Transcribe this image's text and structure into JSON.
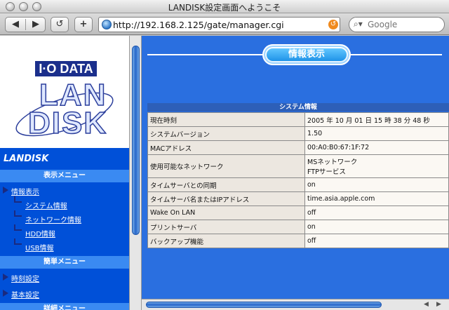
{
  "window": {
    "title": "LANDISK設定画面へようこそ"
  },
  "toolbar": {
    "back_label": "◀",
    "forward_label": "▶",
    "reload_label": "↺",
    "add_label": "+",
    "url": "http://192.168.2.125/gate/manager.cgi",
    "search_placeholder": "Google"
  },
  "sidebar": {
    "logo_top": "I·O DATA",
    "logo_lan": "LAN",
    "logo_disk": "DISK",
    "brand": "LANDISK",
    "display_menu": "表示メニュー",
    "items": [
      {
        "label": "情報表示"
      },
      {
        "label": "システム情報"
      },
      {
        "label": "ネットワーク情報"
      },
      {
        "label": "HDD情報"
      },
      {
        "label": "USB情報"
      }
    ],
    "simple_menu": "簡単メニュー",
    "simple_items": [
      {
        "label": "時刻設定"
      },
      {
        "label": "基本設定"
      }
    ],
    "detail_menu": "詳細メニュー"
  },
  "main": {
    "heading": "情報表示",
    "section": "システム情報",
    "rows": [
      {
        "key": "現在時刻",
        "value": "2005 年 10 月 01 日 15 時 38 分 48 秒"
      },
      {
        "key": "システムバージョン",
        "value": "1.50"
      },
      {
        "key": "MACアドレス",
        "value": "00:A0:B0:67:1F:72"
      },
      {
        "key": "使用可能なネットワーク",
        "value": "MSネットワーク",
        "value2": "FTPサービス"
      },
      {
        "key": "タイムサーバとの同期",
        "value": "on"
      },
      {
        "key": "タイムサーバ名またはIPアドレス",
        "value": "time.asia.apple.com"
      },
      {
        "key": "Wake On LAN",
        "value": "off"
      },
      {
        "key": "プリントサーバ",
        "value": "on"
      },
      {
        "key": "バックアップ機能",
        "value": "off"
      }
    ]
  }
}
